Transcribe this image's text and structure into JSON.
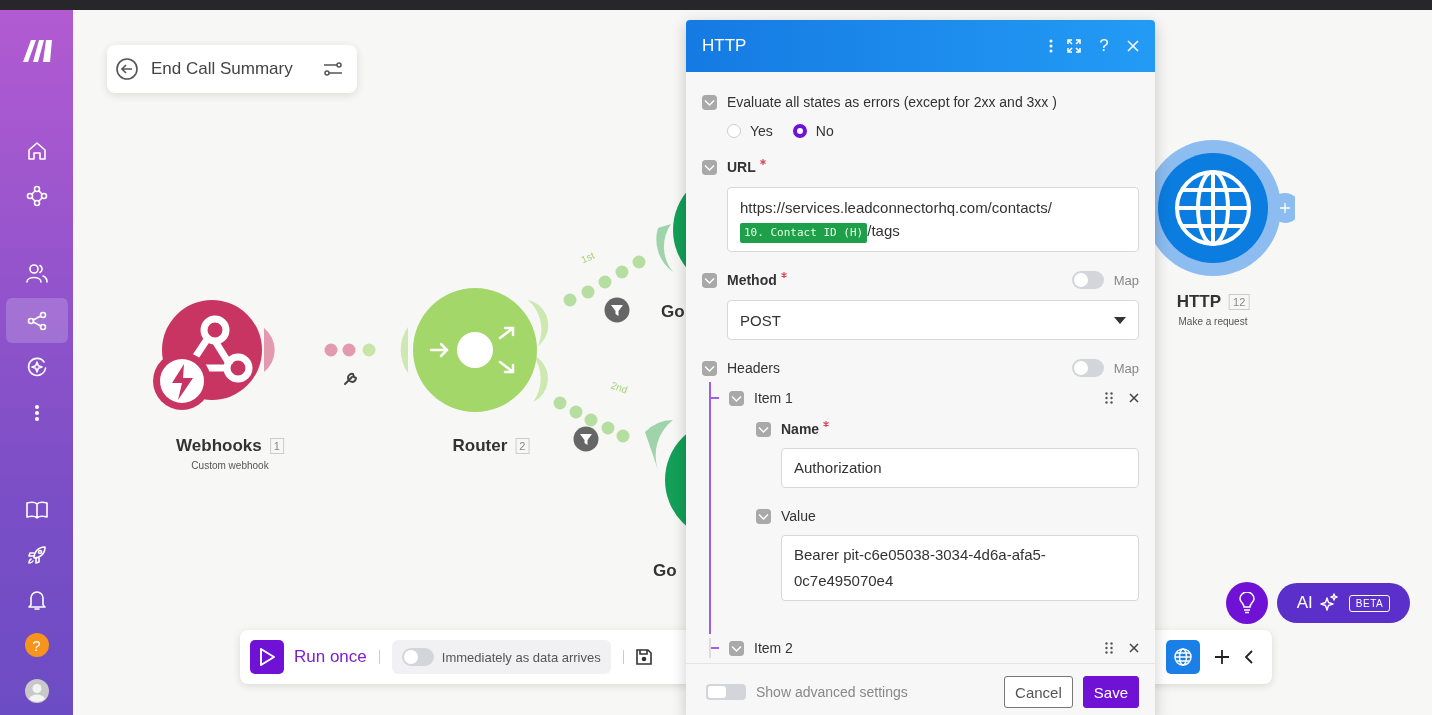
{
  "sidebar": {
    "items": [
      {
        "kind": "logo",
        "selected": false
      },
      {
        "kind": "home",
        "selected": false
      },
      {
        "kind": "apps",
        "selected": false
      },
      {
        "kind": "team",
        "selected": false
      },
      {
        "kind": "scenarios",
        "selected": true
      },
      {
        "kind": "ai",
        "selected": false
      },
      {
        "kind": "more",
        "selected": false
      },
      {
        "kind": "docs",
        "selected": false
      },
      {
        "kind": "launch",
        "selected": false
      },
      {
        "kind": "notifications",
        "selected": false
      },
      {
        "kind": "help",
        "selected": false,
        "label": "?"
      },
      {
        "kind": "avatar",
        "selected": false
      }
    ]
  },
  "scenario": {
    "title": "End Call Summary"
  },
  "nodes": [
    {
      "kind": "webhooks",
      "title": "Webhooks",
      "number": "1",
      "subtitle": "Custom webhook"
    },
    {
      "kind": "router",
      "title": "Router",
      "number": "2"
    },
    {
      "kind": "partial",
      "title": "Go"
    },
    {
      "kind": "partial",
      "title": "Go"
    },
    {
      "kind": "http",
      "title": "HTTP",
      "number": "12",
      "subtitle": "Make a request"
    }
  ],
  "routes": [
    {
      "label": "1st"
    },
    {
      "label": "2nd"
    }
  ],
  "toolbar": {
    "run_button": "Run once",
    "schedule": {
      "label": "Immediately as data arrives",
      "on": false
    }
  },
  "assistant": {
    "label": "AI",
    "badge": "BETA"
  },
  "dialog": {
    "title": "HTTP",
    "header_buttons": [
      {
        "kind": "more"
      },
      {
        "kind": "expand"
      },
      {
        "kind": "help",
        "label": "?"
      },
      {
        "kind": "close"
      }
    ],
    "evaluate": {
      "label": "Evaluate all states as errors (except for 2xx and 3xx )",
      "options": [
        {
          "label": "Yes",
          "selected": false
        },
        {
          "label": "No",
          "selected": true
        }
      ]
    },
    "url": {
      "label": "URL",
      "required": true,
      "parts": [
        {
          "kind": "text",
          "text": "https://services.leadconnectorhq.com/contacts/"
        },
        {
          "kind": "token",
          "text": "10. Contact ID (H)"
        },
        {
          "kind": "text",
          "text": "/tags"
        }
      ]
    },
    "method": {
      "label": "Method",
      "required": true,
      "map": {
        "label": "Map",
        "on": false
      },
      "value": "POST"
    },
    "headers": {
      "label": "Headers",
      "map": {
        "label": "Map",
        "on": false
      },
      "items": [
        {
          "label": "Item 1",
          "fields": [
            {
              "label": "Name",
              "required": true,
              "value": "Authorization"
            },
            {
              "label": "Value",
              "required": false,
              "value": "Bearer pit-c6e05038-3034-4d6a-afa5-0c7e495070e4"
            }
          ]
        },
        {
          "label": "Item 2"
        }
      ]
    },
    "advanced": {
      "label": "Show advanced settings",
      "on": false
    },
    "buttons": [
      {
        "kind": "secondary",
        "label": "Cancel"
      },
      {
        "kind": "primary",
        "label": "Save"
      }
    ]
  }
}
